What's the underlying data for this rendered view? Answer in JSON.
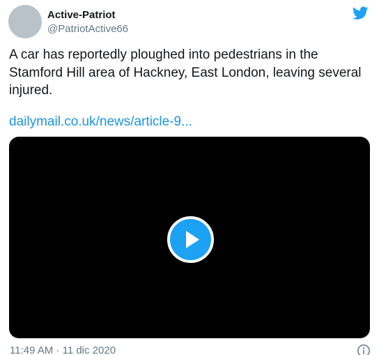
{
  "author": {
    "display_name": "Active-Patriot",
    "handle": "@PatriotActive66"
  },
  "tweet": {
    "text": "A car has reportedly ploughed into pedestrians in the Stamford Hill area of Hackney, East London, leaving several injured.",
    "link_text": "dailymail.co.uk/news/article-9...",
    "timestamp": "11:49 AM · 11 dic 2020"
  },
  "media": {
    "type": "video",
    "play_icon": "play-icon"
  },
  "icons": {
    "brand": "twitter-bird-icon",
    "info": "info-icon"
  },
  "colors": {
    "brand": "#1da1f2",
    "link": "#1b95e0",
    "secondary_text": "#657786",
    "primary_text": "#14171a",
    "avatar_placeholder": "#b9c1c9"
  }
}
